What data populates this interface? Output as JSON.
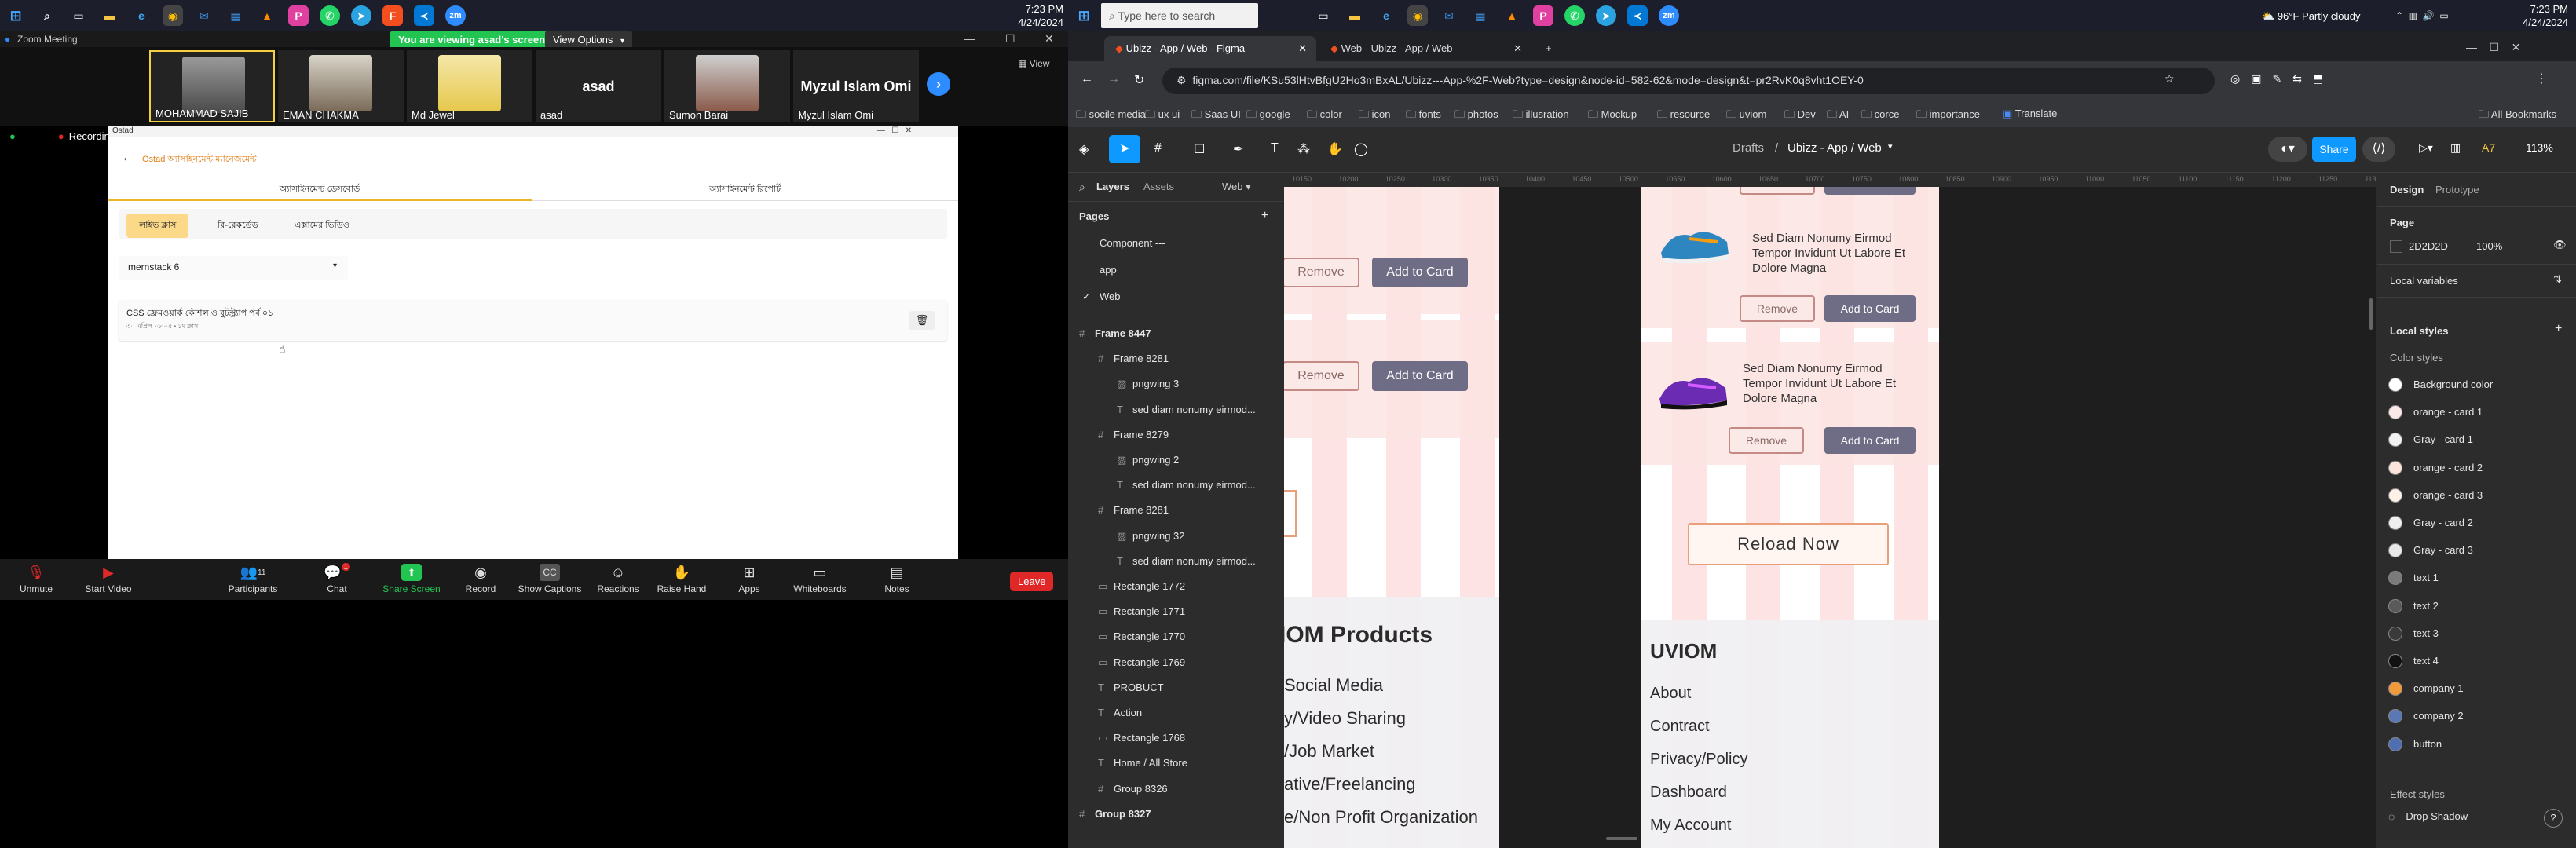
{
  "left_taskbar": {
    "search_icon": "search-icon",
    "clock_time": "7:23 PM",
    "clock_date": "4/24/2024"
  },
  "zoom": {
    "window_title": "Zoom Meeting",
    "share_banner": "You are viewing asad's screen",
    "view_options": "View Options",
    "view_button": "View",
    "recording_label": "Recording",
    "participants": [
      {
        "name": "MOHAMMAD SAJIB",
        "has_photo": true
      },
      {
        "name": "EMAN CHAKMA",
        "has_photo": true
      },
      {
        "name": "Md Jewel",
        "has_photo": true
      },
      {
        "name": "asad",
        "display": "asad",
        "has_photo": false
      },
      {
        "name": "Sumon Barai",
        "has_photo": true
      },
      {
        "name": "Myzul Islam Omi",
        "display": "Myzul Islam Omi",
        "has_photo": false
      }
    ],
    "shared": {
      "app_title": "Ostad",
      "header": "Ostad অ্যাসাইনমেন্ট ম্যানেজমেন্ট",
      "tab_active": "অ্যাসাইনমেন্ট ডেসবোর্ড",
      "tab_inactive": "অ্যাসাইনমেন্ট রিপোর্ট",
      "pills": [
        "লাইভ ক্লাস",
        "রি-রেকর্ডেড",
        "এক্সামের ভিডিও"
      ],
      "dropdown_value": "mernstack 6",
      "item_title": "CSS ফ্রেমওয়ার্ক কৌশল ও বুটস্ট্র্যাপ পর্ব ০১",
      "item_meta": "৩০ এপ্রিল ০৮:০৫ • ১ম ক্লাস"
    },
    "controls": [
      {
        "label": "Unmute",
        "icon": "microphone-muted-icon"
      },
      {
        "label": "Start Video",
        "icon": "video-off-icon"
      },
      {
        "label": "Participants",
        "icon": "participants-icon",
        "count": "11"
      },
      {
        "label": "Chat",
        "icon": "chat-icon",
        "badge": "1"
      },
      {
        "label": "Share Screen",
        "icon": "share-screen-icon"
      },
      {
        "label": "Record",
        "icon": "record-icon"
      },
      {
        "label": "Show Captions",
        "icon": "captions-icon"
      },
      {
        "label": "Reactions",
        "icon": "reactions-icon"
      },
      {
        "label": "Raise Hand",
        "icon": "raise-hand-icon"
      },
      {
        "label": "Apps",
        "icon": "apps-icon"
      },
      {
        "label": "Whiteboards",
        "icon": "whiteboard-icon"
      },
      {
        "label": "Notes",
        "icon": "notes-icon"
      }
    ],
    "leave": "Leave"
  },
  "right_taskbar": {
    "search_placeholder": "Type here to search",
    "weather": "96°F  Partly cloudy",
    "clock_time": "7:23 PM",
    "clock_date": "4/24/2024"
  },
  "chrome": {
    "tabs": [
      {
        "title": "Ubizz - App / Web - Figma",
        "active": true
      },
      {
        "title": "Web - Ubizz - App / Web",
        "active": false
      }
    ],
    "url": "figma.com/file/KSu53lHtvBfgU2Ho3mBxAL/Ubizz---App-%2F-Web?type=design&node-id=582-62&mode=design&t=pr2RvK0q8vht1OEY-0",
    "bookmarks": [
      "socile media",
      "ux ui",
      "Saas UI",
      "google",
      "color",
      "icon",
      "fonts",
      "photos",
      "illusration",
      "Mockup",
      "resource",
      "uviom",
      "Dev",
      "AI",
      "corce",
      "importance",
      "Translate"
    ],
    "all_bookmarks": "All Bookmarks"
  },
  "figma": {
    "breadcrumb_drafts": "Drafts",
    "file_name": "Ubizz - App / Web",
    "share": "Share",
    "zoom": "113%",
    "panel_tabs": [
      "Layers",
      "Assets"
    ],
    "page_selector": "Web",
    "pages_heading": "Pages",
    "pages": [
      "Component ---",
      "app",
      "Web"
    ],
    "layers": [
      {
        "name": "Frame 8447",
        "indent": 0,
        "kind": "frame"
      },
      {
        "name": "Frame 8281",
        "indent": 1,
        "kind": "frame"
      },
      {
        "name": "pngwing 3",
        "indent": 2,
        "kind": "image"
      },
      {
        "name": "sed diam nonumy eirmod...",
        "indent": 2,
        "kind": "text"
      },
      {
        "name": "Frame 8279",
        "indent": 1,
        "kind": "frame"
      },
      {
        "name": "pngwing 2",
        "indent": 2,
        "kind": "image"
      },
      {
        "name": "sed diam nonumy eirmod...",
        "indent": 2,
        "kind": "text"
      },
      {
        "name": "Frame 8281",
        "indent": 1,
        "kind": "frame"
      },
      {
        "name": "pngwing 32",
        "indent": 2,
        "kind": "image"
      },
      {
        "name": "sed diam nonumy eirmod...",
        "indent": 2,
        "kind": "text"
      },
      {
        "name": "Rectangle 1772",
        "indent": 1,
        "kind": "rect"
      },
      {
        "name": "Rectangle 1771",
        "indent": 1,
        "kind": "rect"
      },
      {
        "name": "Rectangle 1770",
        "indent": 1,
        "kind": "rect"
      },
      {
        "name": "Rectangle 1769",
        "indent": 1,
        "kind": "rect"
      },
      {
        "name": "PROBUCT",
        "indent": 1,
        "kind": "text"
      },
      {
        "name": "Action",
        "indent": 1,
        "kind": "text"
      },
      {
        "name": "Rectangle 1768",
        "indent": 1,
        "kind": "rect"
      },
      {
        "name": "Home / All Store",
        "indent": 1,
        "kind": "text"
      },
      {
        "name": "Group 8326",
        "indent": 1,
        "kind": "frame"
      },
      {
        "name": "Group 8327",
        "indent": 0,
        "kind": "frame"
      }
    ],
    "ruler": [
      "10150",
      "10200",
      "10250",
      "10300",
      "10350",
      "10400",
      "10450",
      "10500",
      "10550",
      "10600",
      "10650",
      "10700",
      "10750",
      "10800",
      "10850",
      "10900",
      "10950",
      "11000",
      "11050",
      "11100",
      "11150",
      "11200",
      "11250",
      "11300"
    ],
    "canvas": {
      "remove": "Remove",
      "add_to_card": "Add to Card",
      "product_text": "Sed Diam Nonumy Eirmod Tempor Invidunt Ut Labore Et Dolore Magna",
      "reload": "Reload Now",
      "products_heading": "IOM Products",
      "products_links": [
        "Social Media",
        "y/Video Sharing",
        "/Job Market",
        "ative/Freelancing",
        "e/Non Profit Organization"
      ],
      "uviom_heading": "UVIOM",
      "uviom_links": [
        "About",
        "Contract",
        "Privacy/Policy",
        "Dashboard",
        "My Account"
      ]
    },
    "right_tabs": [
      "Design",
      "Prototype"
    ],
    "page_section": "Page",
    "page_color": "2D2D2D",
    "page_opacity": "100%",
    "local_variables": "Local variables",
    "local_styles": "Local styles",
    "color_styles_heading": "Color styles",
    "color_styles": [
      {
        "name": "Background color",
        "color": "#ffffff"
      },
      {
        "name": "orange - card 1",
        "color": "#fbe9e8"
      },
      {
        "name": "Gray - card 1",
        "color": "#f2f2f2"
      },
      {
        "name": "orange - card 2",
        "color": "#fce4dc"
      },
      {
        "name": "orange - card 3",
        "color": "#fdf0e6"
      },
      {
        "name": "Gray - card 2",
        "color": "#eeeeee"
      },
      {
        "name": "Gray - card 3",
        "color": "#e8e8e8"
      },
      {
        "name": "text 1",
        "color": "#7a7a7a"
      },
      {
        "name": "text 2",
        "color": "#5a5a5a"
      },
      {
        "name": "text 3",
        "color": "#3a3a3a"
      },
      {
        "name": "text 4",
        "color": "#111111"
      },
      {
        "name": "company 1",
        "color": "#f09a3c"
      },
      {
        "name": "company 2",
        "color": "#5a78b5"
      },
      {
        "name": "button",
        "color": "#4f6fb0"
      }
    ],
    "effect_styles_heading": "Effect styles",
    "effect_styles": [
      "Drop Shadow"
    ],
    "help": "?"
  }
}
